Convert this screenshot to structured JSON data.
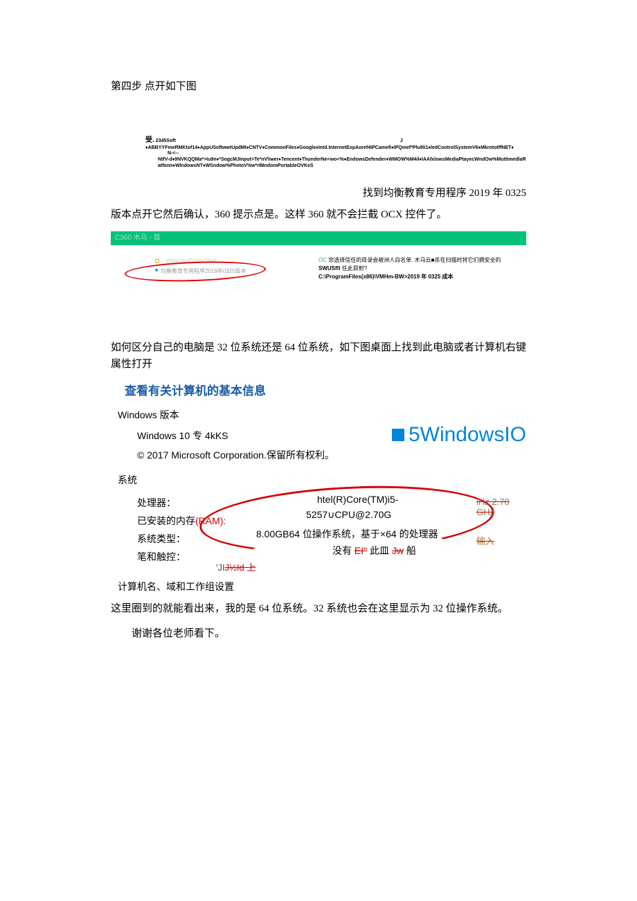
{
  "step_line": "第四步 点开如下图",
  "folder_block": {
    "l1a": "受.",
    "l1b": "2345Soft",
    "l1c": "J",
    "l2": "♦ABBYYFmeRMKtof14♦AppUSoftwwtUpdMt♦CNTV♦CommonFiles♦Google♦Intd.InternetExpAoref4IPCamefi♦IPQmef*Plu9li1♦ledControlSystemV6♦MkrototffNET♦",
    "l2_right": "N-<--",
    "l3": "NtfV-d♦9NVKQQMa*>Iu9n♦*SogcMJInput>Te*nV\\\\wer♦Tencent♦ThunderNe<wo<%♦EndowsDefender♦WMOW%M4il♦IAAfxlowsMediaPtayecWndOw%MuttimedlaRatfonn♦WlndowsNT♦WSndow%PhotoV%w*rlMndomPortableOVKeS",
    "l3_cont": ""
  },
  "right_label": "找到均衡教育专用程序 2019 年 0325",
  "confirm_line": "版本点开它然后确认，360 提示点是。这样 360 就不会拦截 OCX 控件了。",
  "green_bar": "C360 木马 - 首",
  "oval": {
    "line1": "WindowsPowerShell",
    "line2": "均衡教育专用程序2019年0325版本"
  },
  "trust_box": {
    "cyan_prefix": "OC",
    "line1": "您选择信任的目录会被洲人白名单. 木马云■杀在扫描时将它们拥安全的",
    "line2_bold": "SWUSffi",
    "line2_rest": " 任此目射?",
    "line3": "C:\\ProgramFiles(x86)\\VMHm-BW>2019 年 0325 成本"
  },
  "howto_para": "如何区分自己的电脑是 32 位系统还是 64 位系统，如下图桌面上找到此电脑或者计算机右键属性打开",
  "sys_title": "查看有关计算机的基本信息",
  "win": {
    "edition_header": "Windows 版本",
    "edition": "Windows 10 专 4kKS",
    "copyright": "© 2017 Microsoft Corporation.保留所有权利。",
    "logo5": "5",
    "logoText": " WindowsIO"
  },
  "sys": {
    "header": "系统",
    "rows": {
      "cpu_label": "处理器：",
      "cpu_val1": "htel(R)Core(TM)i5-",
      "cpu_val2": "5257∪CPU@2.70G",
      "ghz": "iHz   2.70 GHz",
      "ram_label_pre": "已安装的内存",
      "ram_label_red": "(RAM):",
      "ostype_label": "系统类型：",
      "ostype_val": "8.00GB64 位操作系统，基于×64 的处理器",
      "pen_label": "笔和触控：",
      "nothing_pre": "没有 ",
      "nothing_s1": "EI\"",
      "nothing_mid": " 此皿 ",
      "nothing_s2": "Jw",
      "nothing_end": " 船",
      "input_txt": "输入",
      "jid_pre": "'JI",
      "jid_mid": "J½Id",
      "jid_end": " 上"
    },
    "domain": "计算机名、域和工作组设置"
  },
  "conclusion": "这里圈到的就能看出来，我的是 64 位系统。32 系统也会在这里显示为 32 位操作系统。",
  "thanks": "谢谢各位老师看下。"
}
